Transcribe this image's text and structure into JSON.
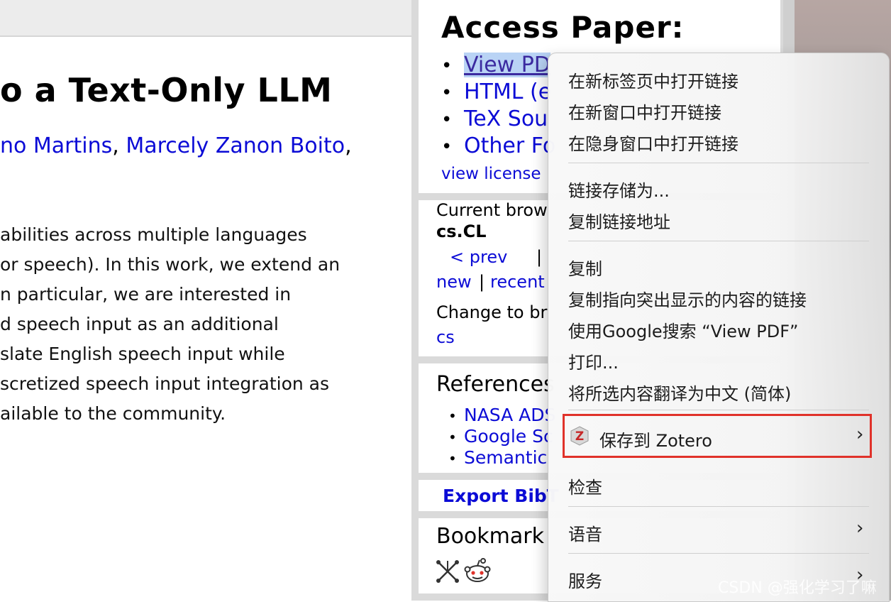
{
  "article": {
    "title": "o a Text-Only LLM",
    "author1": "no Martins",
    "sep": ", ",
    "author2": "Marcely Zanon Boito",
    "trail": ",",
    "abstract_lines": [
      "abilities across multiple languages",
      "or speech). In this work, we extend an",
      "n particular, we are interested in",
      "d speech input as an additional",
      "slate English speech input while",
      "scretized speech input integration as",
      "ailable to the community."
    ]
  },
  "sidebar": {
    "access_heading": "Access Paper:",
    "bullet": "•",
    "downloads": [
      "View PD",
      "HTML (e",
      "TeX Sou",
      "Other Fo"
    ],
    "view_license": "view license",
    "current_browse": "Current brow",
    "category": "cs.CL",
    "prev": "< prev",
    "pipe": "|",
    "new": "new",
    "recent": "recent",
    "change_to": "Change to br",
    "cs": "cs",
    "references_heading": "References",
    "references": [
      "NASA ADS",
      "Google Sc",
      "Semantic"
    ],
    "export": "Export BibT",
    "bookmark_heading": "Bookmark"
  },
  "context_menu": {
    "items": [
      "在新标签页中打开链接",
      "在新窗口中打开链接",
      "在隐身窗口中打开链接",
      "链接存储为...",
      "复制链接地址",
      "复制",
      "复制指向突出显示的内容的链接",
      "使用Google搜索 “View PDF”",
      "打印...",
      "将所选内容翻译为中文 (简体)",
      "保存到 Zotero",
      "检查",
      "语音",
      "服务"
    ],
    "chevron": "›"
  },
  "watermark": "CSDN @强化学习了嘛",
  "colors": {
    "link": "#0b0bd6",
    "highlight_border": "#e0322a",
    "selection": "#b9d3f5"
  },
  "icons": [
    "bibsonomy-icon",
    "reddit-icon",
    "zotero-icon",
    "chevron-right-icon"
  ]
}
